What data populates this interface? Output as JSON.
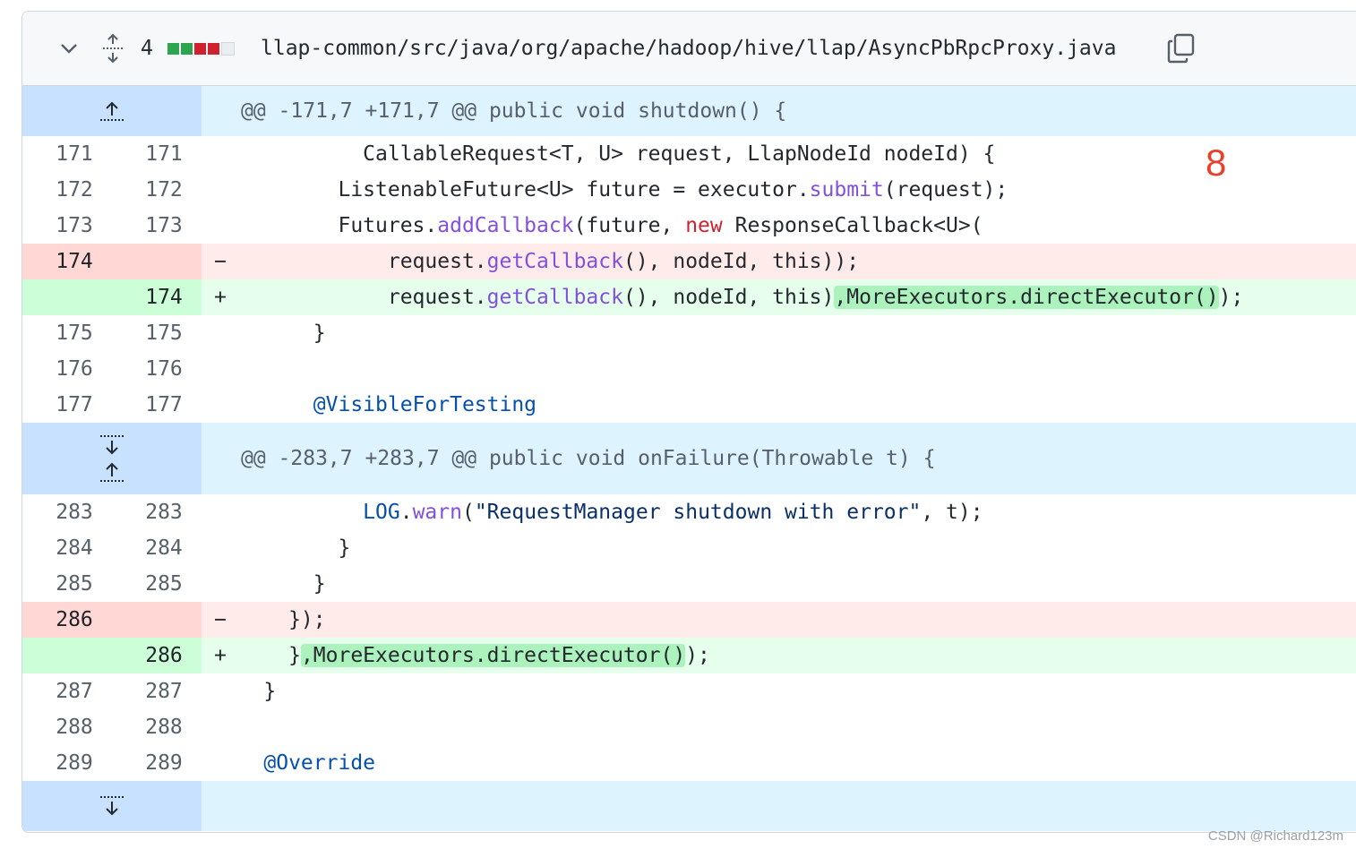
{
  "file": {
    "changes_count": "4",
    "path": "llap-common/src/java/org/apache/hadoop/hive/llap/AsyncPbRpcProxy.java",
    "diffstat": [
      "add",
      "add",
      "del",
      "del",
      "neutral"
    ]
  },
  "colors": {
    "add": "#2da44e",
    "del": "#cf222e",
    "neutral": "#eaeef2",
    "annotation": "#e8402a"
  },
  "hunks": [
    {
      "header": "@@ -171,7 +171,7 @@ public void shutdown() {"
    },
    {
      "header": "@@ -283,7 +283,7 @@ public void onFailure(Throwable t) {"
    }
  ],
  "lines1": [
    {
      "old": "171",
      "new": "171",
      "code": "          CallableRequest<T, U> request, LlapNodeId nodeId) {"
    },
    {
      "old": "172",
      "new": "172",
      "code": "        ListenableFuture<U> future = executor.submit(request);"
    },
    {
      "old": "173",
      "new": "173",
      "code": "        Futures.addCallback(future, new ResponseCallback<U>("
    },
    {
      "old": "174",
      "new": "",
      "sign": "-",
      "code": "            request.getCallback(), nodeId, this));"
    },
    {
      "old": "",
      "new": "174",
      "sign": "+",
      "code": "            request.getCallback(), nodeId, this),MoreExecutors.directExecutor());"
    },
    {
      "old": "175",
      "new": "175",
      "code": "      }"
    },
    {
      "old": "176",
      "new": "176",
      "code": ""
    },
    {
      "old": "177",
      "new": "177",
      "code": "      @VisibleForTesting"
    }
  ],
  "lines2": [
    {
      "old": "283",
      "new": "283",
      "code": "          LOG.warn(\"RequestManager shutdown with error\", t);"
    },
    {
      "old": "284",
      "new": "284",
      "code": "        }"
    },
    {
      "old": "285",
      "new": "285",
      "code": "      }"
    },
    {
      "old": "286",
      "new": "",
      "sign": "-",
      "code": "    });"
    },
    {
      "old": "",
      "new": "286",
      "sign": "+",
      "code": "    },MoreExecutors.directExecutor());"
    },
    {
      "old": "287",
      "new": "287",
      "code": "  }"
    },
    {
      "old": "288",
      "new": "288",
      "code": ""
    },
    {
      "old": "289",
      "new": "289",
      "code": "  @Override"
    }
  ],
  "annotation_label": "8",
  "watermark": "CSDN @Richard123m"
}
